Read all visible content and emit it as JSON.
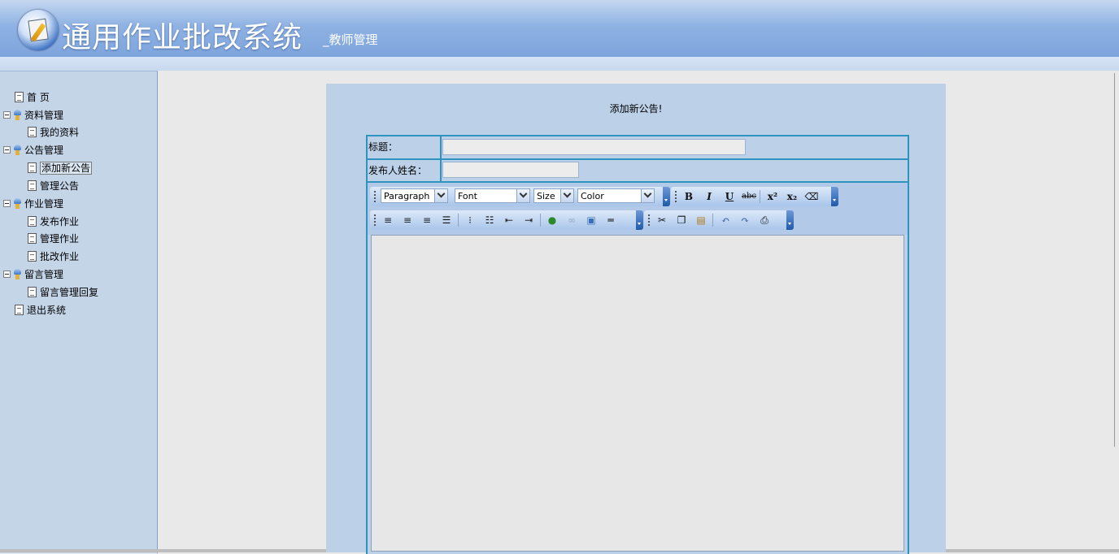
{
  "header": {
    "title": "通用作业批改系统",
    "subtitle": "_教师管理"
  },
  "sidebar": {
    "items": [
      {
        "label": "首 页",
        "type": "page",
        "level": 0
      },
      {
        "label": "资料管理",
        "type": "folder",
        "level": 0
      },
      {
        "label": "我的资料",
        "type": "page",
        "level": 1
      },
      {
        "label": "公告管理",
        "type": "folder",
        "level": 0
      },
      {
        "label": "添加新公告",
        "type": "page",
        "level": 1,
        "selected": true
      },
      {
        "label": "管理公告",
        "type": "page",
        "level": 1
      },
      {
        "label": "作业管理",
        "type": "folder",
        "level": 0
      },
      {
        "label": "发布作业",
        "type": "page",
        "level": 1
      },
      {
        "label": "管理作业",
        "type": "page",
        "level": 1
      },
      {
        "label": "批改作业",
        "type": "page",
        "level": 1
      },
      {
        "label": "留言管理",
        "type": "folder",
        "level": 0
      },
      {
        "label": "留言管理回复",
        "type": "page",
        "level": 1
      },
      {
        "label": "退出系统",
        "type": "page",
        "level": 0
      }
    ]
  },
  "form": {
    "heading": "添加新公告!",
    "title_label": "标题：",
    "title_value": "",
    "author_label": "发布人姓名：",
    "author_value": ""
  },
  "editor": {
    "paragraph": "Paragraph",
    "font": "Font",
    "size": "Size",
    "color": "Color",
    "content": ""
  },
  "colors": {
    "header_gradient": "#7da4dc",
    "sidebar_bg": "#c5d5e8",
    "panel_bg": "#bcd1e8",
    "table_border": "#2f93c0"
  }
}
